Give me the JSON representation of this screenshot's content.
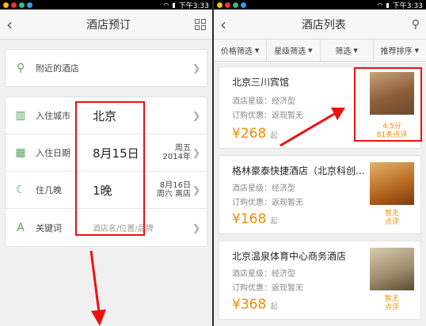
{
  "status": {
    "time": "下午3:33"
  },
  "left": {
    "title": "酒店预订",
    "nearby": "附近的酒店",
    "rows": {
      "city": {
        "label": "入住城市",
        "value": "北京"
      },
      "date": {
        "label": "入住日期",
        "value": "8月15日",
        "side1": "周五",
        "side2": "2014年"
      },
      "nights": {
        "label": "住几晚",
        "value": "1晚",
        "side1": "8月16日",
        "side2": "周六 离店"
      },
      "keyword": {
        "label": "关键词",
        "placeholder": "酒店名/位置/品牌"
      }
    }
  },
  "right": {
    "title": "酒店列表",
    "filters": [
      "价格筛选",
      "星级筛选",
      "筛选",
      "推荐排序"
    ],
    "hotels": [
      {
        "name": "北京三川宾馆",
        "star": "酒店星级：经济型",
        "deal": "订购优惠：返现暂无",
        "price": "¥268",
        "qi": "起",
        "rating1": "4.5分",
        "rating2": "81条点评"
      },
      {
        "name": "格林豪泰快捷酒店（北京科创...",
        "star": "酒店星级：经济型",
        "deal": "订购优惠：返现暂无",
        "price": "¥168",
        "qi": "起",
        "rating1": "暂无",
        "rating2": "点评"
      },
      {
        "name": "北京温泉体育中心商务酒店",
        "star": "酒店星级：经济型",
        "deal": "订购优惠：返现暂无",
        "price": "¥368",
        "qi": "起",
        "rating1": "暂无",
        "rating2": "点评"
      }
    ]
  }
}
